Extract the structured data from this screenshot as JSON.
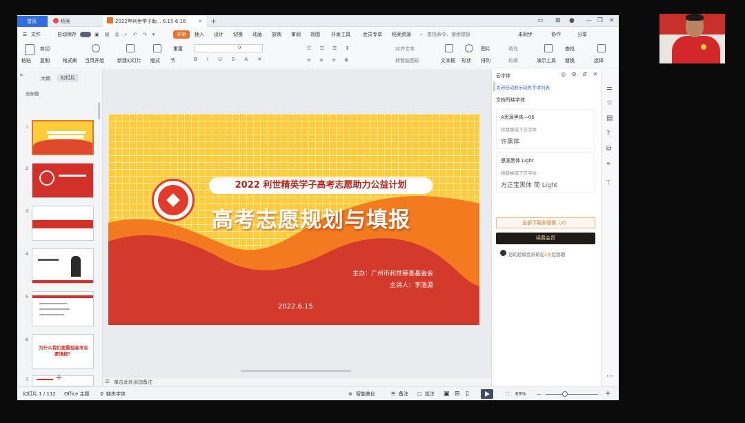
{
  "tabs": {
    "home": "首页",
    "daoke": "稻壳",
    "doc": "2022年利世学子助... 6.15-6.16"
  },
  "menu": {
    "file": "文件",
    "autosave": "自动保存",
    "start": "开始",
    "insert": "插入",
    "design": "设计",
    "switch": "切换",
    "animation": "动画",
    "show": "放映",
    "review": "审阅",
    "view": "视图",
    "devtools": "开发工具",
    "member": "会员专享",
    "resources": "稻壳资源",
    "search_placeholder": "查找命令、搜索模板",
    "unsync": "未同步",
    "collab": "协作",
    "share": "分享"
  },
  "ribbon": {
    "paste": "粘贴",
    "cut": "剪切",
    "copy": "复制",
    "format_painter": "格式刷",
    "play_current": "当页开始",
    "new_slide": "新建幻灯片",
    "layout": "版式",
    "section": "节",
    "reset": "重置",
    "font_size": "0",
    "text_box": "文本框",
    "shape": "形状",
    "picture": "图片",
    "fill": "填充",
    "arrange": "排列",
    "outline": "轮廓",
    "presentation_tool": "演示工具",
    "find": "查找",
    "replace": "替换",
    "select": "选择",
    "align_text": "对齐文本",
    "convert_smartart": "转智能图形"
  },
  "left_panel": {
    "outline_tab": "大纲",
    "slides_tab": "幻灯片",
    "untitled_section": "无标题",
    "slide_numbers": [
      "1",
      "2",
      "3",
      "4",
      "5",
      "6",
      "7"
    ],
    "thumb6_text": "为什么我们要重视高考志愿填报？"
  },
  "slide": {
    "subtitle": "2022 利世精英学子高考志愿助力公益计划",
    "title": "高考志愿规划与填报",
    "host": "主办：广州市利世慈善基金会",
    "speaker": "主讲人：李浩源",
    "date": "2022.6.15"
  },
  "notes_placeholder": "单击此处添加备注",
  "right_panel": {
    "title": "云字体",
    "link": "关闭自动展示缺失字体列表",
    "doc_fonts_label": "文档所缺字体",
    "fonts": [
      {
        "name": "A思源黑体—06",
        "hint": "将替换成下方字体",
        "replacement": "许黑体"
      },
      {
        "name": "思源黑体 Light",
        "hint": "将替换成下方字体",
        "replacement": "方正宝黑体 简 Light"
      }
    ],
    "download_all": "全部下载和替换（2）",
    "renew": "续费会员",
    "notice_before": "您的超级会员将在",
    "notice_days": "2天",
    "notice_after": "后到期"
  },
  "status": {
    "slide_counter": "幻灯片 1 / 112",
    "theme": "Office 主题",
    "missing_fonts": "缺失字体",
    "beautify": "智能美化",
    "notes": "备注",
    "comments": "批注",
    "zoom": "69%"
  },
  "colors": {
    "accent": "#e8702a",
    "slide_bg": "#ffcd3c",
    "slide_red": "#d23a2b",
    "slide_orange": "#f4761f",
    "member_dark": "#1f1b17"
  }
}
